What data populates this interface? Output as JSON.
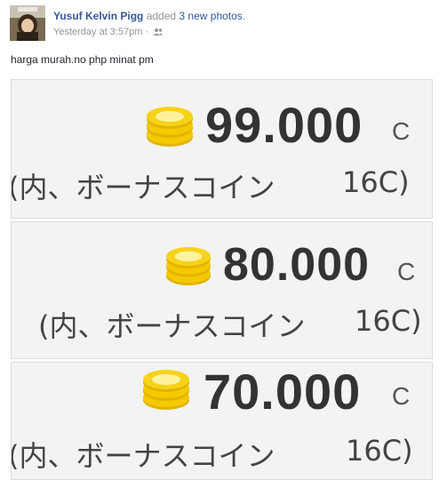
{
  "post": {
    "author": "Yusuf Kelvin Pigg",
    "action_prefix": "added",
    "action_link": "3 new photos",
    "action_suffix": ".",
    "timestamp": "Yesterday at 3:57pm",
    "separator": "·",
    "audience_icon": "friends-icon",
    "text": "harga murah.no php minat pm"
  },
  "photos": [
    {
      "amount": "99.000",
      "unit": "C",
      "bonus_label": "(内、ボーナスコイン",
      "bonus_count": "16C)"
    },
    {
      "amount": "80.000",
      "unit": "C",
      "bonus_label": "(内、ボーナスコイン",
      "bonus_count": "16C)"
    },
    {
      "amount": "70.000",
      "unit": "C",
      "bonus_label": "(内、ボーナスコイン",
      "bonus_count": "16C)"
    }
  ],
  "colors": {
    "link": "#365899",
    "meta": "#90949c",
    "coin_gold": "#f5c900",
    "coin_light": "#fff3a0"
  }
}
